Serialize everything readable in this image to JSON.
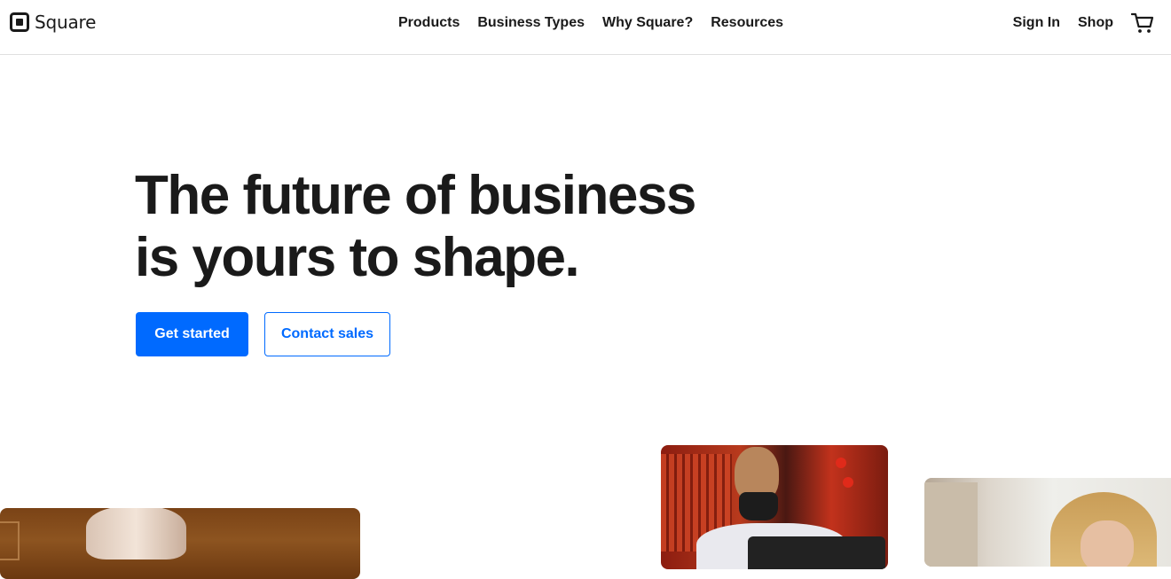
{
  "brand": {
    "name": "Square",
    "logo_icon": "square-logo-icon"
  },
  "nav": {
    "primary": [
      {
        "label": "Products"
      },
      {
        "label": "Business Types"
      },
      {
        "label": "Why Square?"
      },
      {
        "label": "Resources"
      }
    ],
    "sign_in": "Sign In",
    "shop": "Shop",
    "cart_icon": "cart-icon"
  },
  "hero": {
    "title_line1": "The future of business",
    "title_line2": "is yours to shape.",
    "cta_primary": "Get started",
    "cta_secondary": "Contact sales"
  },
  "colors": {
    "accent": "#006aff",
    "text": "#1a1a1a",
    "background": "#ffffff",
    "divider": "#e0e0e0"
  }
}
